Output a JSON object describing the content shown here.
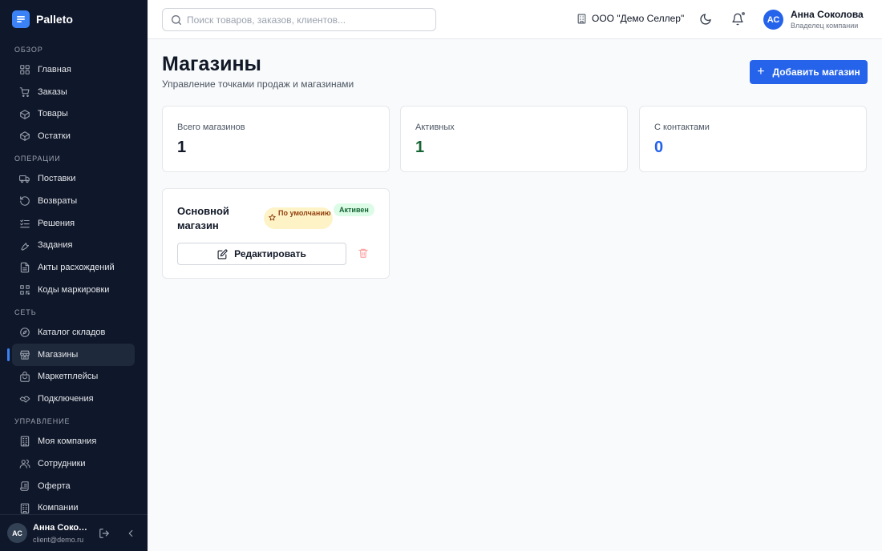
{
  "app": {
    "name": "Palleto"
  },
  "colors": {
    "accent": "#2563eb",
    "sidebar_bg": "#0f172a",
    "active_green": "#166534",
    "contacts_blue": "#2563eb"
  },
  "sidebar": {
    "sections": [
      {
        "title": "ОБЗОР",
        "items": [
          {
            "label": "Главная",
            "icon": "dashboard-icon"
          },
          {
            "label": "Заказы",
            "icon": "cart-icon"
          },
          {
            "label": "Товары",
            "icon": "box-icon"
          },
          {
            "label": "Остатки",
            "icon": "box-icon"
          }
        ]
      },
      {
        "title": "ОПЕРАЦИИ",
        "items": [
          {
            "label": "Поставки",
            "icon": "truck-icon"
          },
          {
            "label": "Возвраты",
            "icon": "return-icon"
          },
          {
            "label": "Решения",
            "icon": "checklist-icon"
          },
          {
            "label": "Задания",
            "icon": "wrench-icon"
          },
          {
            "label": "Акты расхождений",
            "icon": "document-icon"
          },
          {
            "label": "Коды маркировки",
            "icon": "qr-icon"
          }
        ]
      },
      {
        "title": "СЕТЬ",
        "items": [
          {
            "label": "Каталог складов",
            "icon": "compass-icon"
          },
          {
            "label": "Магазины",
            "icon": "store-icon",
            "active": true
          },
          {
            "label": "Маркетплейсы",
            "icon": "bag-icon"
          },
          {
            "label": "Подключения",
            "icon": "handshake-icon"
          }
        ]
      },
      {
        "title": "УПРАВЛЕНИЕ",
        "items": [
          {
            "label": "Моя компания",
            "icon": "building-icon"
          },
          {
            "label": "Сотрудники",
            "icon": "users-icon"
          },
          {
            "label": "Оферта",
            "icon": "scroll-icon"
          },
          {
            "label": "Компании",
            "icon": "building-icon"
          }
        ]
      }
    ],
    "footer": {
      "avatar": "АС",
      "name": "Анна Соколова",
      "email": "client@demo.ru"
    }
  },
  "header": {
    "search_placeholder": "Поиск товаров, заказов, клиентов...",
    "company": "ООО \"Демо Селлер\"",
    "user": {
      "initials": "АС",
      "name": "Анна Соколова",
      "role": "Владелец компании"
    }
  },
  "page": {
    "title": "Магазины",
    "subtitle": "Управление точками продаж и магазинами",
    "add_button": "Добавить магазин"
  },
  "stats": [
    {
      "label": "Всего магазинов",
      "value": "1",
      "color": "#111827"
    },
    {
      "label": "Активных",
      "value": "1",
      "color": "#166534"
    },
    {
      "label": "С контактами",
      "value": "0",
      "color": "#2563eb"
    }
  ],
  "stores": [
    {
      "name": "Основной магазин",
      "badge_default": "По умолчанию",
      "status": "Активен",
      "edit_label": "Редактировать"
    }
  ]
}
